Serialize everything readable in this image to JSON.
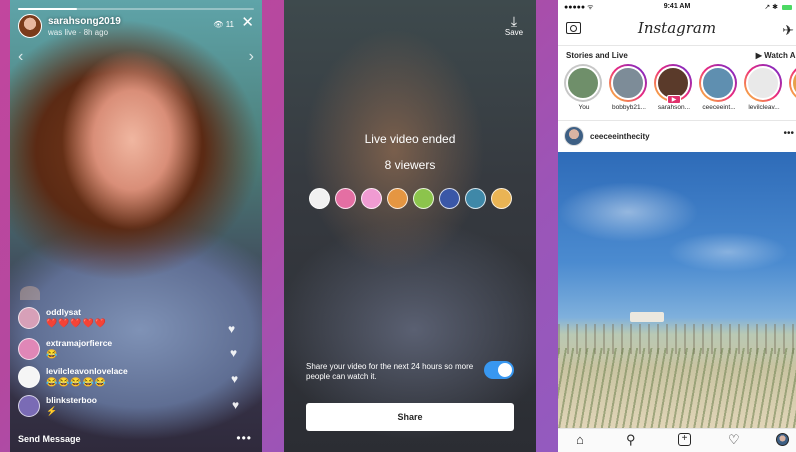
{
  "live_video": {
    "username": "sarahsong2019",
    "status": "was live · 8h ago",
    "viewer_count": "11",
    "progress": 0.25,
    "comments": [
      {
        "user": "oddlysat",
        "text": "❤️❤️❤️❤️❤️",
        "color": "#d7a0b8"
      },
      {
        "user": "extramajorfierce",
        "text": "😂",
        "color": "#e087b7"
      },
      {
        "user": "levilcleavonlovelace",
        "text": "😂😂😂😂😂",
        "color": "#f5f5f5"
      },
      {
        "user": "blinksterboo",
        "text": "⚡",
        "color": "#7a6bb5"
      }
    ],
    "send_message": "Send Message",
    "more": "•••"
  },
  "live_ended": {
    "save_label": "Save",
    "title": "Live video ended",
    "viewers": "8 viewers",
    "viewer_avatar_colors": [
      "#f1f1f1",
      "#e46fa3",
      "#f09bd2",
      "#e59642",
      "#8cc44c",
      "#3a57a7",
      "#3f88a8",
      "#eab454"
    ],
    "share_text": "Share your video for the next 24 hours so more people can watch it.",
    "share_toggle_on": true,
    "share_button": "Share",
    "accent_color": "#3897f0"
  },
  "feed": {
    "status_time": "9:41 AM",
    "status_left": "●●●●● ᯤ",
    "status_right": "↗ ✱",
    "logo": "Instagram",
    "stories_label": "Stories and Live",
    "watch_all": "▶ Watch All",
    "stories": [
      {
        "label": "You",
        "color": "#6f8f6a",
        "seen": true,
        "live": false
      },
      {
        "label": "bobbyb21...",
        "color": "#7d8c98",
        "seen": false,
        "live": false
      },
      {
        "label": "sarahson...",
        "color": "#5a3a2a",
        "seen": false,
        "live": true
      },
      {
        "label": "ceeceeint...",
        "color": "#5f8fb0",
        "seen": false,
        "live": false
      },
      {
        "label": "levilcleav...",
        "color": "#e9e9e9",
        "seen": false,
        "live": false
      },
      {
        "label": "ins",
        "color": "#e7a04a",
        "seen": false,
        "live": false
      }
    ],
    "post_user": "ceeceeinthecity",
    "post_more": "•••"
  }
}
